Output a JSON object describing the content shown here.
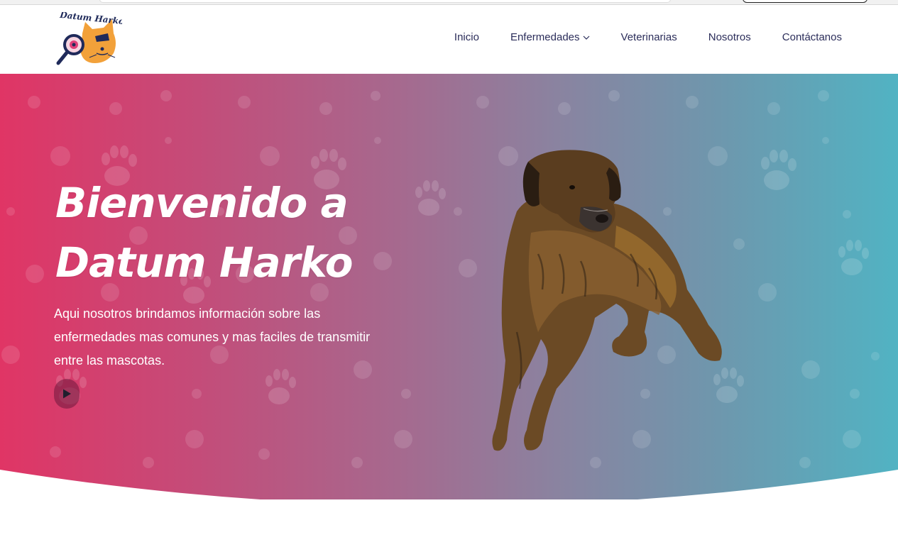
{
  "site": {
    "logo_text": "Datum Harko"
  },
  "nav": {
    "items": [
      {
        "label": "Inicio"
      },
      {
        "label": "Enfermedades",
        "has_dropdown": true
      },
      {
        "label": "Veterinarias"
      },
      {
        "label": "Nosotros"
      },
      {
        "label": "Contáctanos"
      }
    ]
  },
  "hero": {
    "title_line1": "Bienvenido a",
    "title_line2": "Datum Harko",
    "description": "Aqui nosotros brindamos información sobre las enfermedades mas comunes y mas faciles de transmitir entre las mascotas.",
    "play_icon": "play-icon",
    "gradient": {
      "start": "#e03565",
      "middle": "#8a83a0",
      "end": "#51b3c3"
    }
  },
  "colors": {
    "nav_text": "#2b2d5a",
    "logo_orange": "#f2a13a",
    "logo_navy": "#1f2a5a",
    "logo_pink": "#e0407a"
  }
}
